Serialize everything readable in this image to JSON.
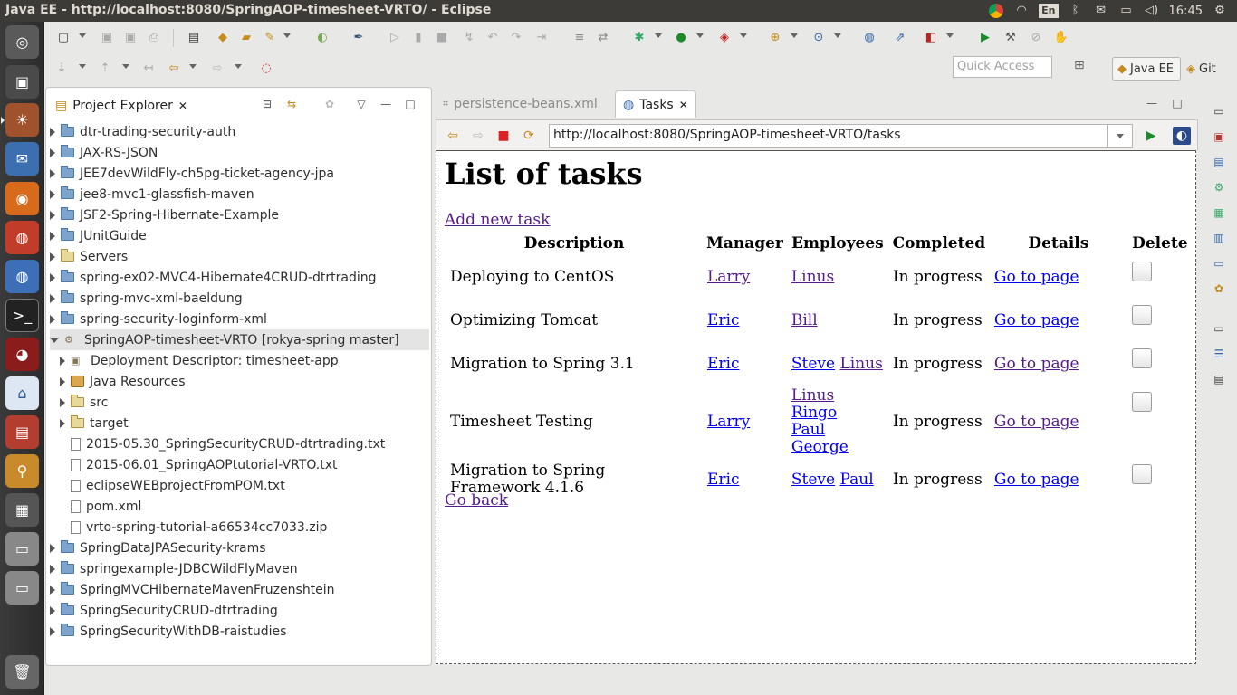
{
  "window": {
    "title": "Java EE - http://localhost:8080/SpringAOP-timesheet-VRTO/ - Eclipse"
  },
  "tray": {
    "keyboard": "En",
    "time": "16:45"
  },
  "toolbar": {
    "quick_access_placeholder": "Quick Access",
    "perspectives": [
      {
        "label": "Java EE"
      },
      {
        "label": "Git"
      }
    ]
  },
  "project_explorer": {
    "title": "Project Explorer",
    "items": [
      {
        "label": "dtr-trading-security-auth"
      },
      {
        "label": "JAX-RS-JSON"
      },
      {
        "label": "JEE7devWildFly-ch5pg-ticket-agency-jpa"
      },
      {
        "label": "jee8-mvc1-glassfish-maven"
      },
      {
        "label": "JSF2-Spring-Hibernate-Example"
      },
      {
        "label": "JUnitGuide"
      },
      {
        "label": "Servers"
      },
      {
        "label": "spring-ex02-MVC4-Hibernate4CRUD-dtrtrading"
      },
      {
        "label": "spring-mvc-xml-baeldung"
      },
      {
        "label": "spring-security-loginform-xml"
      },
      {
        "label": "SpringAOP-timesheet-VRTO  [rokya-spring master]"
      },
      {
        "label": "Deployment Descriptor: timesheet-app"
      },
      {
        "label": "Java Resources"
      },
      {
        "label": "src"
      },
      {
        "label": "target"
      },
      {
        "label": "2015-05.30_SpringSecurityCRUD-dtrtrading.txt"
      },
      {
        "label": "2015-06.01_SpringAOPtutorial-VRTO.txt"
      },
      {
        "label": "eclipseWEBprojectFromPOM.txt"
      },
      {
        "label": "pom.xml"
      },
      {
        "label": "vrto-spring-tutorial-a66534cc7033.zip"
      },
      {
        "label": "SpringDataJPASecurity-krams"
      },
      {
        "label": "springexample-JDBCWildFlyMaven"
      },
      {
        "label": "SpringMVCHibernateMavenFruzenshtein"
      },
      {
        "label": "SpringSecurityCRUD-dtrtrading"
      },
      {
        "label": "SpringSecurityWithDB-raistudies"
      }
    ]
  },
  "editor": {
    "tabs": [
      {
        "label": "persistence-beans.xml"
      },
      {
        "label": "Tasks"
      }
    ],
    "url": "http://localhost:8080/SpringAOP-timesheet-VRTO/tasks"
  },
  "page": {
    "heading": "List of tasks",
    "add_link": "Add new task",
    "back_link": "Go back",
    "columns": [
      "Description",
      "Manager",
      "Employees",
      "Completed",
      "Details",
      "Delete"
    ],
    "rows": [
      {
        "description": "Deploying to CentOS",
        "manager": "Larry",
        "employees": [
          "Linus"
        ],
        "completed": "In progress",
        "details": "Go to page"
      },
      {
        "description": "Optimizing Tomcat",
        "manager": "Eric",
        "employees": [
          "Bill"
        ],
        "completed": "In progress",
        "details": "Go to page"
      },
      {
        "description": "Migration to Spring 3.1",
        "manager": "Eric",
        "employees": [
          "Steve",
          "Linus"
        ],
        "completed": "In progress",
        "details": "Go to page"
      },
      {
        "description": "Timesheet Testing",
        "manager": "Larry",
        "employees": [
          "Linus",
          "Ringo",
          "Paul",
          "George"
        ],
        "completed": "In progress",
        "details": "Go to page"
      },
      {
        "description": "Migration to Spring Framework 4.1.6",
        "manager": "Eric",
        "employees": [
          "Steve",
          "Paul"
        ],
        "completed": "In progress",
        "details": "Go to page"
      }
    ]
  }
}
